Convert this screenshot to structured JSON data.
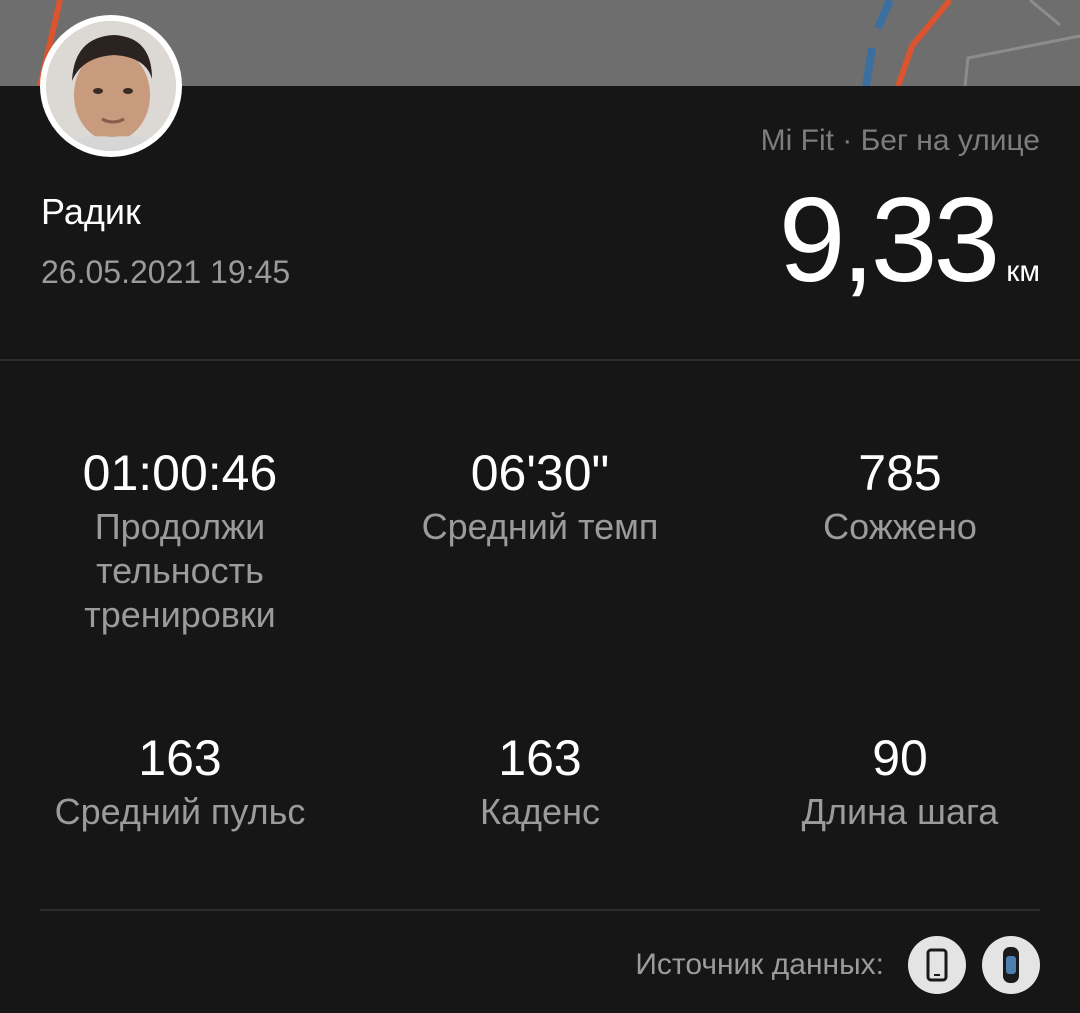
{
  "user": {
    "name": "Радик",
    "date": "26.05.2021 19:45"
  },
  "workout": {
    "source_type": "Mi Fit · Бег на улице",
    "distance": "9,33",
    "distance_unit": "км"
  },
  "stats": [
    {
      "value": "01:00:46",
      "label": "Продолжи тельность тренировки"
    },
    {
      "value": "06'30\"",
      "label": "Средний темп"
    },
    {
      "value": "785",
      "label": "Сожжено"
    },
    {
      "value": "163",
      "label": "Средний пульс"
    },
    {
      "value": "163",
      "label": "Каденс"
    },
    {
      "value": "90",
      "label": "Длина шага"
    }
  ],
  "footer": {
    "data_source_label": "Источник данных:",
    "sources": [
      "phone-icon",
      "band-icon"
    ]
  },
  "colors": {
    "background": "#161616",
    "map": "#6e6e6e",
    "route": "#d9542f",
    "text_primary": "#ffffff",
    "text_secondary": "#9b9b9b"
  }
}
